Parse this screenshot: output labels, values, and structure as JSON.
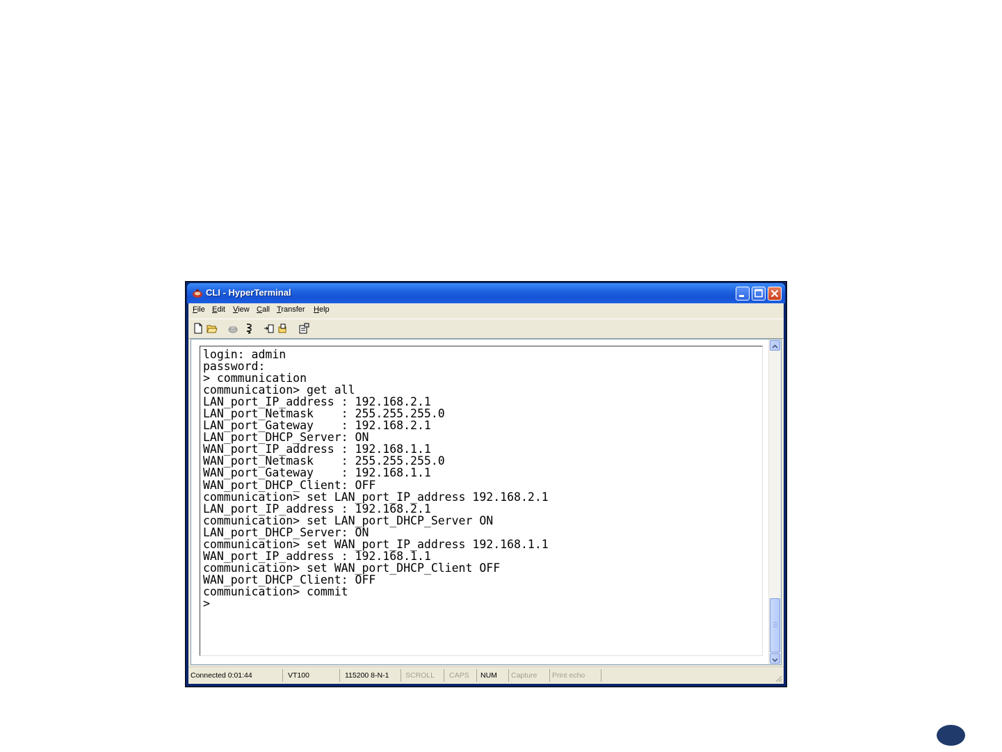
{
  "window": {
    "title": "CLI - HyperTerminal"
  },
  "menu": [
    {
      "label": "File"
    },
    {
      "label": "Edit"
    },
    {
      "label": "View"
    },
    {
      "label": "Call"
    },
    {
      "label": "Transfer"
    },
    {
      "label": "Help"
    }
  ],
  "toolbar": [
    {
      "icon": "new-document-icon"
    },
    {
      "icon": "open-folder-icon"
    },
    {
      "icon": "call-phone-icon"
    },
    {
      "icon": "disconnect-icon"
    },
    {
      "icon": "send-file-icon"
    },
    {
      "icon": "receive-file-icon"
    },
    {
      "icon": "properties-icon"
    }
  ],
  "terminal": {
    "lines": [
      "login: admin",
      "password:",
      "> communication",
      "communication> get all",
      "LAN_port_IP_address : 192.168.2.1",
      "LAN_port_Netmask    : 255.255.255.0",
      "LAN_port_Gateway    : 192.168.2.1",
      "LAN_port_DHCP_Server: ON",
      "WAN_port_IP_address : 192.168.1.1",
      "WAN_port_Netmask    : 255.255.255.0",
      "WAN_port_Gateway    : 192.168.1.1",
      "WAN_port_DHCP_Client: OFF",
      "communication> set LAN_port_IP_address 192.168.2.1",
      "LAN_port_IP_address : 192.168.2.1",
      "communication> set LAN_port_DHCP_Server ON",
      "LAN_port_DHCP_Server: ON",
      "communication> set WAN_port_IP_address 192.168.1.1",
      "WAN_port_IP_address : 192.168.1.1",
      "communication> set WAN_port_DHCP_Client OFF",
      "WAN_port_DHCP_Client: OFF",
      "communication> commit",
      ">"
    ],
    "scroll_position": 1.0
  },
  "status": {
    "connected": "Connected 0:01:44",
    "emulation": "VT100",
    "port_settings": "115200 8-N-1",
    "scroll": "SCROLL",
    "caps": "CAPS",
    "num": "NUM",
    "capture": "Capture",
    "print_echo": "Print echo"
  },
  "colors": {
    "title_bar": "#1f63e0",
    "page_badge": "#1f3a6b"
  }
}
